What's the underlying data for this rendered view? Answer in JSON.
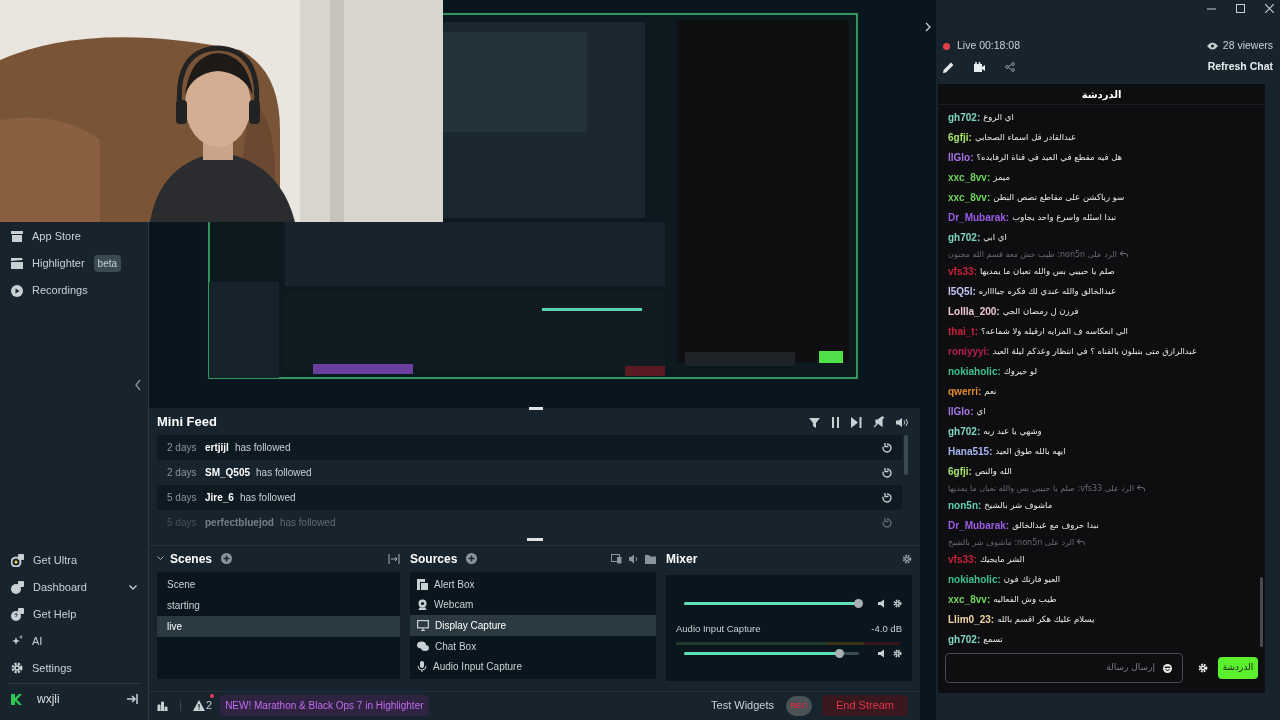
{
  "sidebar": {
    "items": [
      {
        "label": "App Store"
      },
      {
        "label": "Highlighter",
        "badge": "beta"
      },
      {
        "label": "Recordings"
      }
    ],
    "bottom_items": [
      {
        "label": "Get Ultra",
        "kind": "link"
      },
      {
        "label": "Dashboard",
        "kind": "dropdown"
      },
      {
        "label": "Get Help",
        "kind": "link"
      },
      {
        "label": "AI",
        "kind": "link"
      },
      {
        "label": "Settings",
        "kind": "link"
      }
    ],
    "user": {
      "name": "wxjli"
    }
  },
  "mini_feed": {
    "title": "Mini Feed",
    "rows": [
      {
        "time": "2 days",
        "name": "ertjijl",
        "action": "has followed",
        "faded": false
      },
      {
        "time": "2 days",
        "name": "SM_Q505",
        "action": "has followed",
        "faded": false
      },
      {
        "time": "5 days",
        "name": "Jire_6",
        "action": "has followed",
        "faded": false
      },
      {
        "time": "5 days",
        "name": "perfectbluejod",
        "action": "has followed",
        "faded": true
      }
    ]
  },
  "scenes": {
    "title": "Scenes",
    "items": [
      {
        "label": "Scene",
        "selected": false
      },
      {
        "label": "starting",
        "selected": false
      },
      {
        "label": "live",
        "selected": true
      }
    ]
  },
  "sources": {
    "title": "Sources",
    "items": [
      {
        "label": "Alert Box",
        "selected": false
      },
      {
        "label": "Webcam",
        "selected": false
      },
      {
        "label": "Display Capture",
        "selected": true
      },
      {
        "label": "Chat Box",
        "selected": false
      },
      {
        "label": "Audio Input Capture",
        "selected": false
      }
    ]
  },
  "mixer": {
    "title": "Mixer",
    "channels": [
      {
        "level": 1
      },
      {
        "name": "Audio Input Capture",
        "reading": "-4.0 dB",
        "level": 0.89
      }
    ]
  },
  "footer": {
    "alerts": "2",
    "banner": "NEW! Marathon & Black Ops 7 in Highlighter",
    "test_widgets": "Test Widgets",
    "rec": "REC",
    "end_stream": "End Stream"
  },
  "chat_panel": {
    "live": "Live 00:18:08",
    "viewers": "28 viewers",
    "refresh": "Refresh Chat",
    "title": "الدردشة",
    "messages": [
      {
        "kind": "message",
        "name": "gh702:",
        "color": "#7fd6c4",
        "text": "اي الروع"
      },
      {
        "kind": "message",
        "name": "6gfji:",
        "color": "#a6e06a",
        "text": "عبدالقادر قل اسماء الصحابي"
      },
      {
        "kind": "message",
        "name": "llGlo:",
        "color": "#a774e6",
        "text": "هل فيه مقطع في العيد في قناة الرفايده؟"
      },
      {
        "kind": "message",
        "name": "xxc_8vv:",
        "color": "#6fd45a",
        "text": "ميمز"
      },
      {
        "kind": "message",
        "name": "xxc_8vv:",
        "color": "#6fd45a",
        "text": "سو رياكشن على مقاطع تصص البطن"
      },
      {
        "kind": "message",
        "name": "Dr_Mubarak:",
        "color": "#9b5de5",
        "text": "نبدا اسئله واسرع واحد يجاوب"
      },
      {
        "kind": "message",
        "name": "gh702:",
        "color": "#7fd6c4",
        "text": "اي ابي"
      },
      {
        "kind": "reply",
        "text": "الرد على non5n: طيب خش معه قسم الله مجنون"
      },
      {
        "kind": "message",
        "name": "vfs33:",
        "color": "#c8203c",
        "text": "صلم يا حبيبي بس والله تعبان ما يمديها"
      },
      {
        "kind": "message",
        "name": "I5Q5l:",
        "color": "#c4c4f4",
        "text": "عبدالخالق والله عندي لك فكره جبااااره"
      },
      {
        "kind": "message",
        "name": "Lollla_200:",
        "color": "#f0c8d4",
        "text": "فرزن ل رمضان الجي"
      },
      {
        "kind": "message",
        "name": "thai_t:",
        "color": "#c8203c",
        "text": "الي انعكاسه ف المرايه ارقيله ولا شماعه؟"
      },
      {
        "kind": "message",
        "name": "roniyyyi:",
        "color": "#b8204c",
        "text": "عبدالرازق متى بتبلون بالقناه ؟ في انتظار وعدكم ليلة العيد"
      },
      {
        "kind": "message",
        "name": "nokiaholic:",
        "color": "#3fc08e",
        "text": "لو خيروك"
      },
      {
        "kind": "message",
        "name": "qwerri:",
        "color": "#e08a30",
        "text": "نعم"
      },
      {
        "kind": "message",
        "name": "llGlo:",
        "color": "#a774e6",
        "text": "اي"
      },
      {
        "kind": "message",
        "name": "gh702:",
        "color": "#7fd6c4",
        "text": "وشهي يا عبد ربه"
      },
      {
        "kind": "message",
        "name": "Hana515:",
        "color": "#a4b4f0",
        "text": "ايهه بالله طوق العيد"
      },
      {
        "kind": "message",
        "name": "6gfji:",
        "color": "#a6e06a",
        "text": "الله والنص"
      },
      {
        "kind": "reply",
        "text": "الرد على vfs33: صلم يا حبيبي بس والله تعبان ما يمديها"
      },
      {
        "kind": "message",
        "name": "non5n:",
        "color": "#5fd0b0",
        "text": "ماشوف شر بالشيخ"
      },
      {
        "kind": "message",
        "name": "Dr_Mubarak:",
        "color": "#9b5de5",
        "text": "نبدا حروف مع عبدالخالق"
      },
      {
        "kind": "reply",
        "text": "الرد على non5n: ماشوف شر بالشيخ"
      },
      {
        "kind": "message",
        "name": "vfs33:",
        "color": "#c8203c",
        "text": "الشر مايجيك"
      },
      {
        "kind": "message",
        "name": "nokiaholic:",
        "color": "#3fc08e",
        "text": "العيو فارتك فون"
      },
      {
        "kind": "message",
        "name": "xxc_8vv:",
        "color": "#6fd45a",
        "text": "طيب وش الفعاليه"
      },
      {
        "kind": "message",
        "name": "Llim0_23:",
        "color": "#f0d4a4",
        "text": "يسلام عليك هكر اقسم بالله"
      },
      {
        "kind": "message",
        "name": "gh702:",
        "color": "#7fd6c4",
        "text": "تسمع"
      }
    ],
    "input_placeholder": "إرسال رسالة",
    "send_button": "الدردشة"
  }
}
